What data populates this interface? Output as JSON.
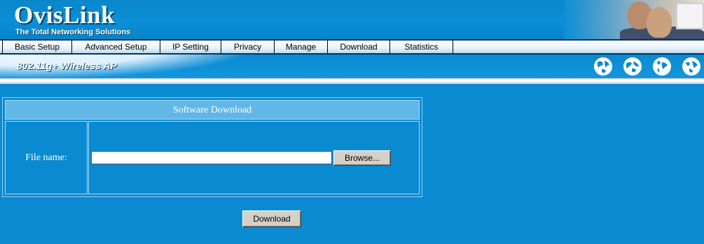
{
  "header": {
    "logo": "OvisLink",
    "tagline": "The Total Networking Solutions"
  },
  "nav": {
    "items": [
      {
        "label": "Basic Setup"
      },
      {
        "label": "Advanced Setup"
      },
      {
        "label": "IP Setting"
      },
      {
        "label": "Privacy"
      },
      {
        "label": "Manage"
      },
      {
        "label": "Download"
      },
      {
        "label": "Statistics"
      }
    ]
  },
  "banner": {
    "title": "802.11g+ Wireless AP",
    "icons": [
      "globe-icon",
      "globe-icon",
      "globe-icon",
      "globe-icon"
    ]
  },
  "download_panel": {
    "heading": "Software Download",
    "file_label": "File name:",
    "file_value": "",
    "browse_label": "Browse..."
  },
  "actions": {
    "download_label": "Download"
  },
  "colors": {
    "page_bg": "#0a8ad0",
    "panel_header": "#61b7e8",
    "nav_border": "#05355a"
  }
}
